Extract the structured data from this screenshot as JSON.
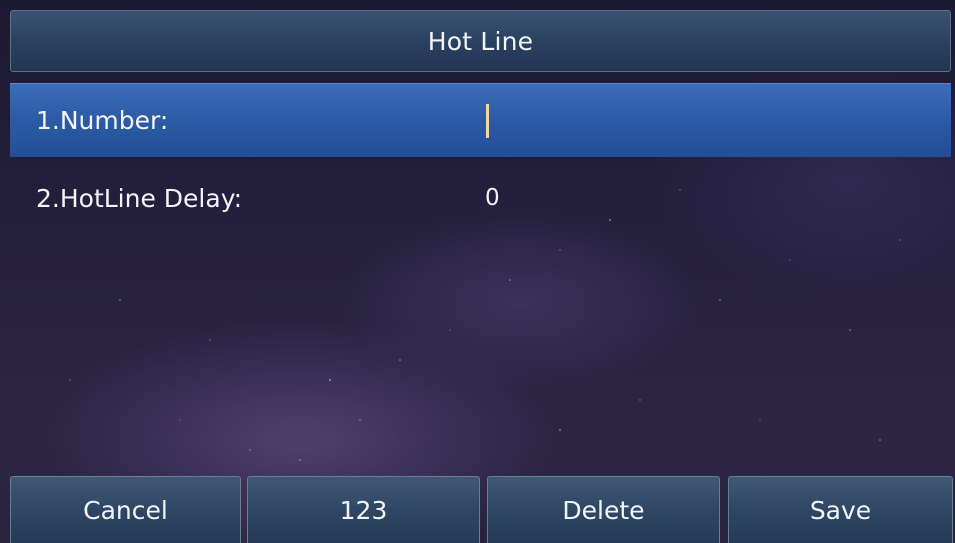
{
  "title": "Hot Line",
  "fields": [
    {
      "label": "1.Number:",
      "value": ""
    },
    {
      "label": "2.HotLine Delay:",
      "value": "0"
    }
  ],
  "softkeys": [
    {
      "label": "Cancel"
    },
    {
      "label": "123"
    },
    {
      "label": "Delete"
    },
    {
      "label": "Save"
    }
  ],
  "colors": {
    "title_bar": "#2b4160",
    "selected_row": "#2c5aa5",
    "softkey": "#2f4764",
    "cursor": "#f0d9a8",
    "background": "#241f3d"
  }
}
